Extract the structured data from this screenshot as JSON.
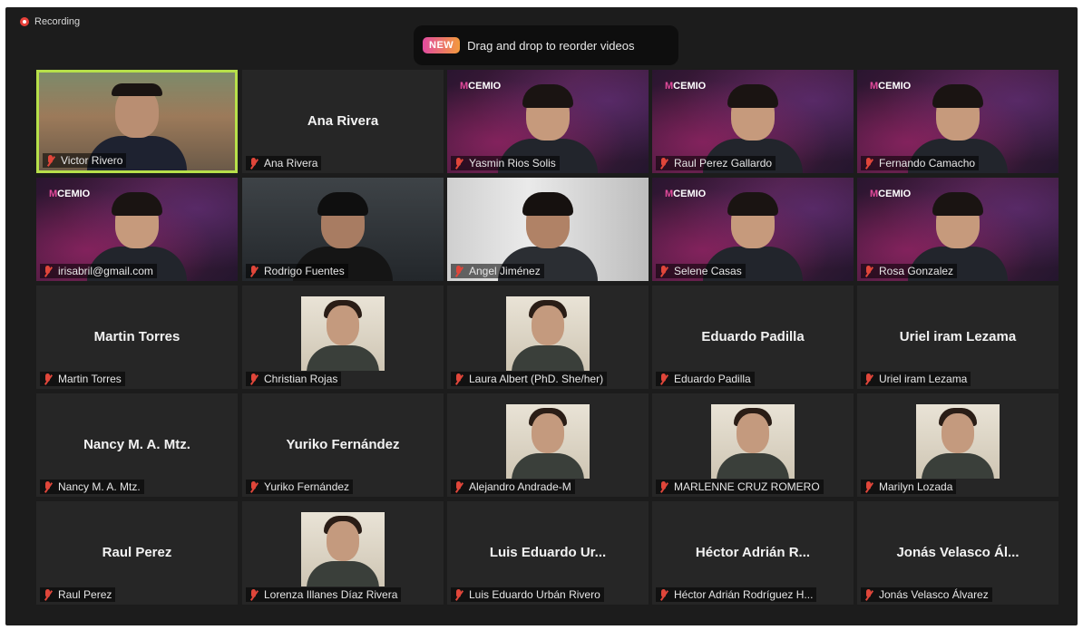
{
  "recording_label": "Recording",
  "banner": {
    "badge": "NEW",
    "text": "Drag and drop to reorder videos"
  },
  "tiles": [
    {
      "name": "Victor Rivero",
      "kind": "video-city"
    },
    {
      "name": "Ana Rivera",
      "center": "Ana Rivera",
      "kind": "name"
    },
    {
      "name": "Yasmin Rios Solis",
      "kind": "cemio"
    },
    {
      "name": "Raul Perez Gallardo",
      "kind": "cemio"
    },
    {
      "name": "Fernando Camacho",
      "kind": "cemio"
    },
    {
      "name": "irisabril@gmail.com",
      "kind": "cemio"
    },
    {
      "name": "Rodrigo Fuentes",
      "kind": "video-dark"
    },
    {
      "name": "Angel Jiménez",
      "kind": "video-office"
    },
    {
      "name": "Selene Casas",
      "kind": "cemio"
    },
    {
      "name": "Rosa Gonzalez",
      "kind": "cemio"
    },
    {
      "name": "Martin Torres",
      "center": "Martin Torres",
      "kind": "name"
    },
    {
      "name": "Christian Rojas",
      "kind": "photo"
    },
    {
      "name": "Laura Albert (PhD. She/her)",
      "kind": "photo"
    },
    {
      "name": "Eduardo Padilla",
      "center": "Eduardo Padilla",
      "kind": "name"
    },
    {
      "name": "Uriel iram Lezama",
      "center": "Uriel iram Lezama",
      "kind": "name"
    },
    {
      "name": "Nancy M. A. Mtz.",
      "center": "Nancy M. A. Mtz.",
      "kind": "name"
    },
    {
      "name": "Yuriko Fernández",
      "center": "Yuriko Fernández",
      "kind": "name"
    },
    {
      "name": "Alejandro Andrade-M",
      "kind": "photo"
    },
    {
      "name": "MARLENNE CRUZ ROMERO",
      "kind": "photo"
    },
    {
      "name": "Marilyn Lozada",
      "kind": "photo"
    },
    {
      "name": "Raul Perez",
      "center": "Raul Perez",
      "kind": "name"
    },
    {
      "name": "Lorenza Illanes Díaz Rivera",
      "kind": "photo"
    },
    {
      "name": "Luis Eduardo Urbán Rivero",
      "center": "Luis Eduardo Ur...",
      "kind": "name"
    },
    {
      "name": "Héctor Adrián Rodríguez H...",
      "center": "Héctor Adrián R...",
      "kind": "name"
    },
    {
      "name": "Jonás Velasco Álvarez",
      "center": "Jonás Velasco Ál...",
      "kind": "name"
    }
  ],
  "colors": {
    "active_speaker": "#b7e04a",
    "muted": "#e0463a",
    "background": "#1c1c1c"
  }
}
